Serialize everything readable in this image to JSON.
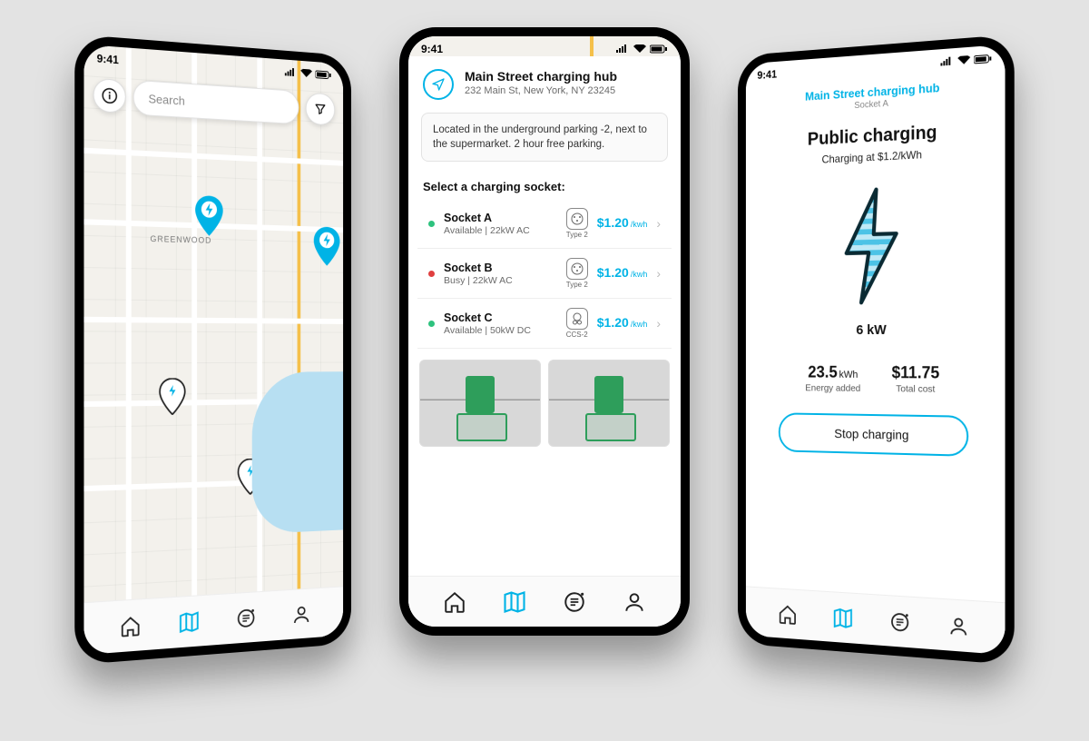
{
  "status": {
    "time": "9:41"
  },
  "map": {
    "search_placeholder": "Search",
    "neighborhood": "GREENWOOD"
  },
  "hub": {
    "title": "Main Street charging hub",
    "address": "232 Main St, New York, NY 23245",
    "note": "Located in the underground parking -2, next to the supermarket. 2 hour free parking.",
    "select_label": "Select a charging socket:",
    "sockets": [
      {
        "name": "Socket A",
        "status": "Available",
        "spec": "22kW AC",
        "plug": "Type 2",
        "price": "$1.20",
        "unit": "/kwh",
        "dot": "#2ec27e"
      },
      {
        "name": "Socket B",
        "status": "Busy",
        "spec": "22kW AC",
        "plug": "Type 2",
        "price": "$1.20",
        "unit": "/kwh",
        "dot": "#e04040"
      },
      {
        "name": "Socket C",
        "status": "Available",
        "spec": "50kW DC",
        "plug": "CCS-2",
        "price": "$1.20",
        "unit": "/kwh",
        "dot": "#2ec27e"
      }
    ]
  },
  "session": {
    "hub_name": "Main Street charging hub",
    "socket": "Socket A",
    "headline": "Public charging",
    "rate_line": "Charging at $1.2/kWh",
    "power": "6 kW",
    "energy_value": "23.5",
    "energy_unit": "kWh",
    "energy_label": "Energy added",
    "cost_value": "$11.75",
    "cost_label": "Total cost",
    "stop_label": "Stop charging"
  }
}
